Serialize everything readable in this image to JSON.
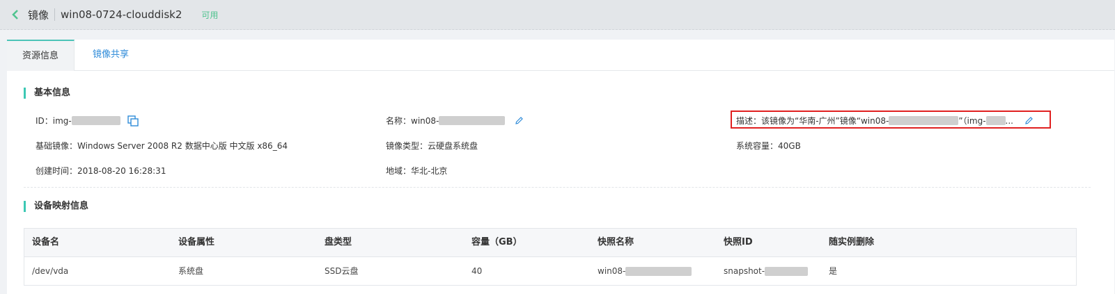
{
  "header": {
    "back_icon": "chevron-left-icon",
    "section": "镜像",
    "image_name": "win08-0724-clouddisk2",
    "status": "可用",
    "accent_color": "#4fc38f"
  },
  "tabs": [
    {
      "label": "资源信息",
      "active": true
    },
    {
      "label": "镜像共享",
      "active": false
    }
  ],
  "basic_info": {
    "title": "基本信息",
    "id_label": "ID：img-",
    "name_label": "名称：win08-",
    "desc_label": "描述：该镜像为“华南-广州”镜像“win08-",
    "desc_mid": "”（img-",
    "desc_end": "...",
    "base_image": "基础镜像：Windows Server 2008 R2 数据中心版 中文版 x86_64",
    "image_type": "镜像类型：云硬盘系统盘",
    "system_capacity": "系统容量：40GB",
    "created_time": "创建时间：2018-08-20 16:28:31",
    "region": "地域：华北-北京"
  },
  "device_mapping": {
    "title": "设备映射信息",
    "columns": [
      "设备名",
      "设备属性",
      "盘类型",
      "容量（GB）",
      "快照名称",
      "快照ID",
      "随实例删除"
    ],
    "rows": [
      {
        "device": "/dev/vda",
        "attr": "系统盘",
        "disk_type": "SSD云盘",
        "capacity": "40",
        "snapshot_name": "win08-",
        "snapshot_id": "snapshot-",
        "delete_with_instance": "是"
      }
    ]
  }
}
